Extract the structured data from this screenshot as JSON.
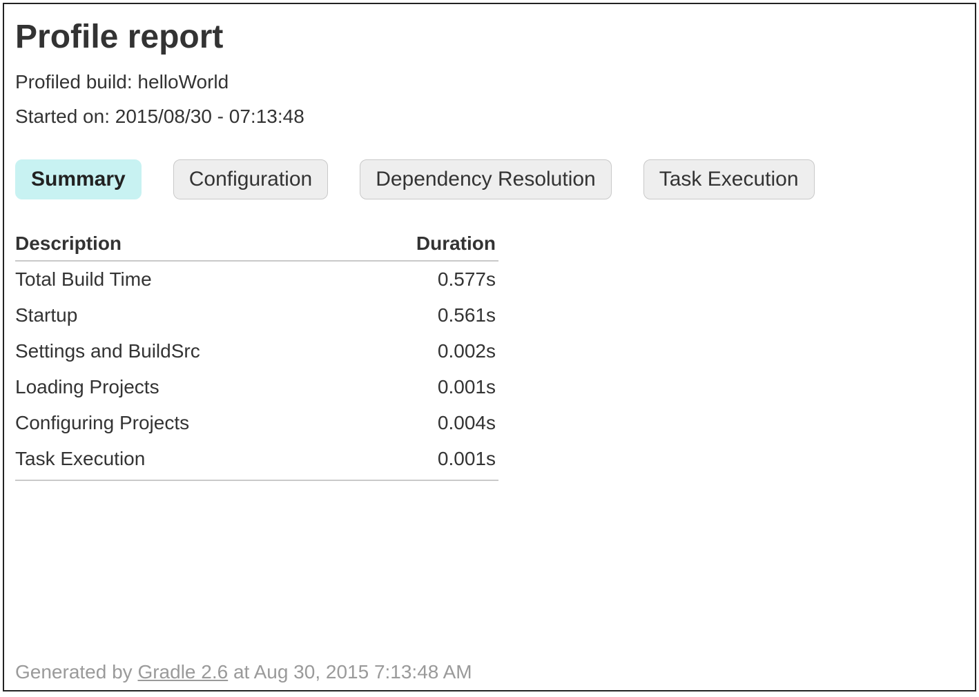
{
  "header": {
    "title": "Profile report",
    "build_line": "Profiled build: helloWorld",
    "started_line": "Started on: 2015/08/30 - 07:13:48"
  },
  "tabs": [
    {
      "label": "Summary",
      "active": true
    },
    {
      "label": "Configuration",
      "active": false
    },
    {
      "label": "Dependency Resolution",
      "active": false
    },
    {
      "label": "Task Execution",
      "active": false
    }
  ],
  "table": {
    "headers": {
      "desc": "Description",
      "dur": "Duration"
    },
    "rows": [
      {
        "desc": "Total Build Time",
        "dur": "0.577s"
      },
      {
        "desc": "Startup",
        "dur": "0.561s"
      },
      {
        "desc": "Settings and BuildSrc",
        "dur": "0.002s"
      },
      {
        "desc": "Loading Projects",
        "dur": "0.001s"
      },
      {
        "desc": "Configuring Projects",
        "dur": "0.004s"
      },
      {
        "desc": "Task Execution",
        "dur": "0.001s"
      }
    ]
  },
  "footer": {
    "prefix": "Generated by ",
    "link": "Gradle 2.6",
    "suffix": " at Aug 30, 2015 7:13:48 AM"
  }
}
